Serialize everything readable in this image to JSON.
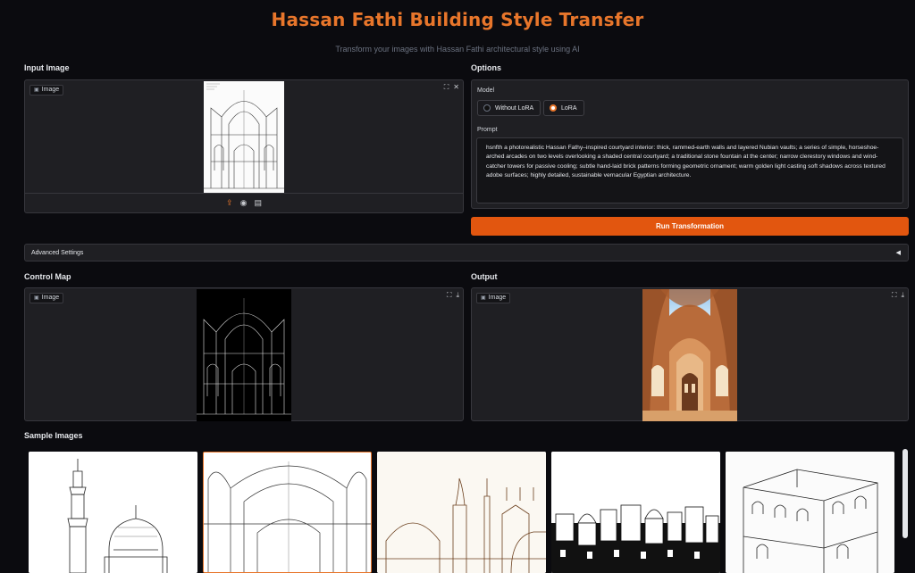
{
  "header": {
    "title": "Hassan Fathi Building Style Transfer",
    "subtitle": "Transform your images with Hassan Fathi architectural style using AI"
  },
  "input_image": {
    "section_label": "Input Image",
    "badge": "Image"
  },
  "options": {
    "section_label": "Options",
    "model_label": "Model",
    "model_options": [
      "Without LoRA",
      "LoRA"
    ],
    "selected_model": "LoRA",
    "prompt_label": "Prompt",
    "prompt_value": "hsnfth  a photorealistic Hassan Fathy–inspired courtyard interior: thick, rammed-earth walls and layered Nubian vaults; a series of simple, horseshoe-arched arcades on two levels overlooking a shaded central courtyard; a traditional stone fountain at the center; narrow clerestory windows and wind-catcher towers for passive cooling; subtle hand-laid brick patterns forming geometric ornament; warm golden light casting soft shadows across textured adobe surfaces; highly detailed, sustainable vernacular Egyptian architecture.",
    "run_button": "Run Transformation"
  },
  "advanced": {
    "label": "Advanced Settings"
  },
  "control_map": {
    "section_label": "Control Map",
    "badge": "Image"
  },
  "output": {
    "section_label": "Output",
    "badge": "Image"
  },
  "samples": {
    "section_label": "Sample Images",
    "items": [
      "mosque-minaret-sketch",
      "arched-interior-sketch",
      "domed-city-sketch",
      "town-skyline-sketch",
      "cubic-houses-sketch"
    ]
  },
  "colors": {
    "accent": "#e8762b",
    "button": "#e2560f",
    "background": "#0b0b0f",
    "panel": "#1f1f23"
  },
  "icons": {
    "fullscreen": "fullscreen-icon",
    "close": "close-icon",
    "download": "download-icon",
    "upload": "upload-icon",
    "webcam": "webcam-icon",
    "clipboard": "clipboard-icon",
    "image": "image-icon",
    "collapse": "triangle-left-icon"
  }
}
